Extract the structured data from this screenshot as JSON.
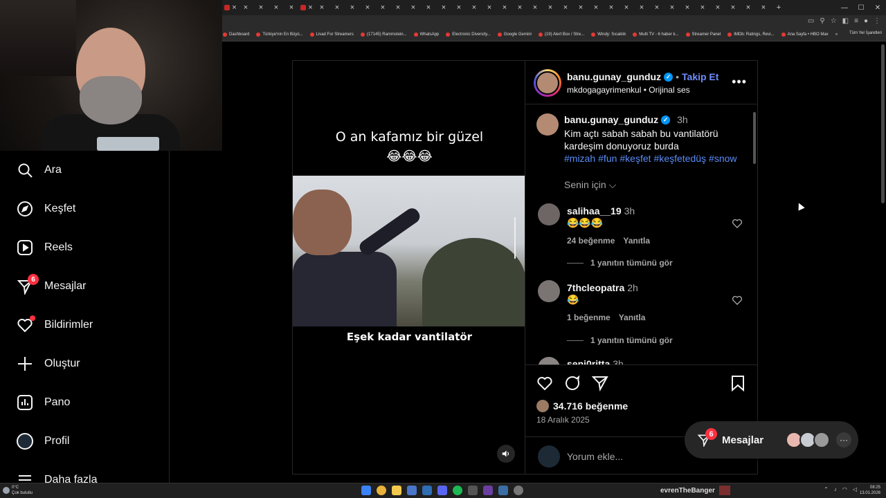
{
  "browser": {
    "bookmarks": [
      "Dashboard",
      "Türkiye'nin En Büyü...",
      "Livad For Streamers",
      "(17145) Rammstein...",
      "WhatsApp",
      "Electronic Diversity...",
      "Google Gemini",
      "(19) Alert Box / Stre...",
      "Windy: Sıcaklık",
      "Multi TV - 6 haber k...",
      "Streamer Panel",
      "IMDb: Ratings, Revi...",
      "Ana Sayfa • HBO Max"
    ],
    "bookmarks_more": "»",
    "all_bookmarks": "Tüm Yer İşaretleri",
    "new_tab": "+"
  },
  "nav": {
    "items": [
      {
        "label": "Ara",
        "icon": "search-icon"
      },
      {
        "label": "Keşfet",
        "icon": "compass-icon"
      },
      {
        "label": "Reels",
        "icon": "reels-icon"
      },
      {
        "label": "Mesajlar",
        "icon": "messenger-icon",
        "badge": "6"
      },
      {
        "label": "Bildirimler",
        "icon": "heart-icon"
      },
      {
        "label": "Oluştur",
        "icon": "plus-icon"
      },
      {
        "label": "Pano",
        "icon": "dashboard-icon"
      },
      {
        "label": "Profil",
        "icon": "profile-avatar"
      },
      {
        "label": "Daha fazla",
        "icon": "menu-icon"
      }
    ]
  },
  "video": {
    "caption_line1": "O an kafamız bir güzel",
    "caption_emojis": "😂😂😂",
    "subtitle": "Eşek kadar vantilatör"
  },
  "post": {
    "username": "banu.gunay_gunduz",
    "separator": "•",
    "follow_label": "Takip Et",
    "audio_source": "mkdogagayrimenkul",
    "audio_label": "Orijinal ses",
    "more_label": "•••",
    "caption_time": "3h",
    "caption_text": "Kim açtı sabah sabah bu vantilatörü kardeşim donuyoruz burda",
    "hashtags": [
      "#mizah",
      "#fun",
      "#keşfet",
      "#keşfetedüş",
      "#snow"
    ],
    "sort_label": "Senin için",
    "likes": "34.716 beğenme",
    "date": "18 Aralık 2025",
    "comment_placeholder": "Yorum ekle..."
  },
  "comments": [
    {
      "user": "salihaa__19",
      "time": "3h",
      "text": "😂😂😂",
      "likes": "24 beğenme",
      "reply": "Yanıtla",
      "replies": "1 yanıtın tümünü gör"
    },
    {
      "user": "7thcleopatra",
      "time": "2h",
      "text": "😂",
      "likes": "1 beğenme",
      "reply": "Yanıtla",
      "replies": "1 yanıtın tümünü gör"
    },
    {
      "user": "seni0ritta",
      "time": "3h"
    }
  ],
  "messages_pill": {
    "label": "Mesajlar",
    "badge": "6",
    "more": "···"
  },
  "taskbar": {
    "weather_temp": "0°C",
    "weather_desc": "Çok bulutlu",
    "user": "evrenTheBanger",
    "time": "08:25",
    "date": "13.01.2026"
  },
  "colors": {
    "accent_link": "#6f8dfc",
    "badge": "#ff3040",
    "verified": "#0095f6",
    "hashtag": "#5b8cf7"
  }
}
